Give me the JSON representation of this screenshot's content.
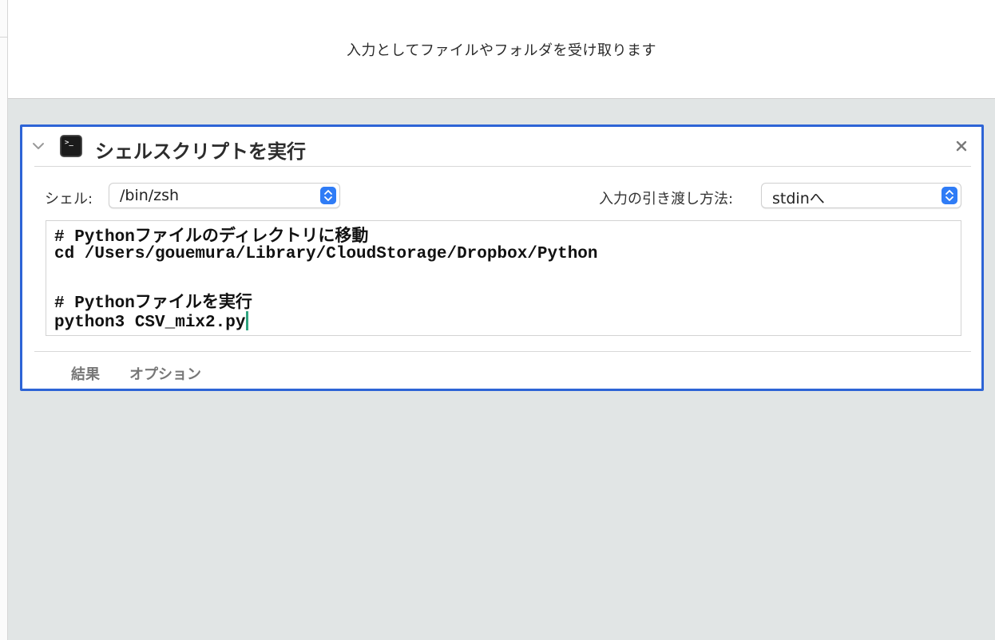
{
  "header": {
    "description": "入力としてファイルやフォルダを受け取ります"
  },
  "action": {
    "title": "シェルスクリプトを実行",
    "shell_label": "シェル:",
    "shell_value": "/bin/zsh",
    "pass_input_label": "入力の引き渡し方法:",
    "pass_input_value": "stdinへ",
    "script_lines": [
      "# Pythonファイルのディレクトリに移動",
      "cd /Users/gouemura/Library/CloudStorage/Dropbox/Python",
      "",
      "# Pythonファイルを実行",
      "python3 CSV_mix2.py"
    ],
    "tabs": {
      "results": "結果",
      "options": "オプション"
    }
  },
  "icons": {
    "collapse": "chevron-down-icon",
    "terminal": "terminal-icon",
    "close": "close-icon",
    "stepper": "up-down-chevron-icon"
  },
  "colors": {
    "selection_border": "#2d64d6",
    "stepper_blue": "#2f7cf6",
    "caret": "#2fa37f"
  }
}
